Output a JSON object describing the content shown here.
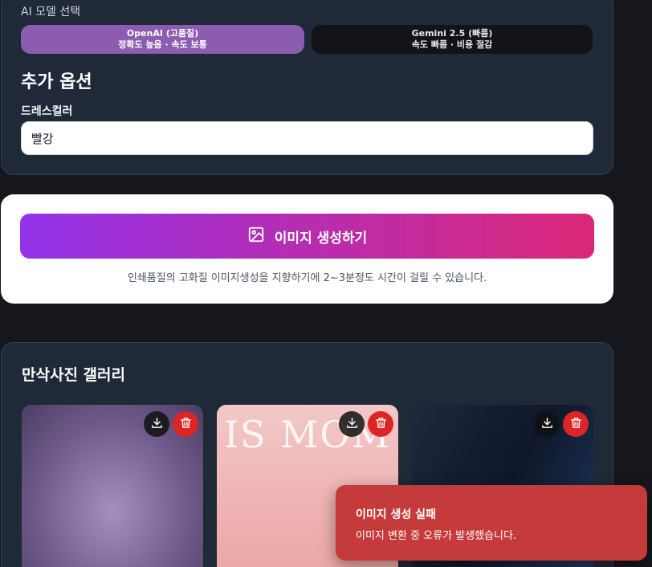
{
  "model_select": {
    "label": "AI 모델 선택",
    "options": [
      {
        "name": "OpenAI (고품질)",
        "desc": "정확도 높음 · 속도 보통",
        "selected": true
      },
      {
        "name": "Gemini 2.5 (빠름)",
        "desc": "속도 빠름 · 비용 절감",
        "selected": false
      }
    ]
  },
  "options": {
    "title": "추가 옵션",
    "dress_color_label": "드레스컬러",
    "dress_color_value": "빨강"
  },
  "generate": {
    "button_label": "이미지 생성하기",
    "note": "인쇄품질의 고화질 이미지생성을 지향하기에 2~3분정도 시간이 걸릴 수 있습니다."
  },
  "gallery": {
    "title": "만삭사진 갤러리",
    "cards": [
      {
        "overlay_text": ""
      },
      {
        "overlay_text": "IS MOM"
      },
      {
        "overlay_text": ""
      }
    ]
  },
  "toast": {
    "title": "이미지 생성 실패",
    "message": "이미지 변환 중 오류가 발생했습니다."
  },
  "colors": {
    "accent_purple": "#9333ea",
    "accent_pink": "#db2777",
    "error_red": "#c53a3a"
  }
}
